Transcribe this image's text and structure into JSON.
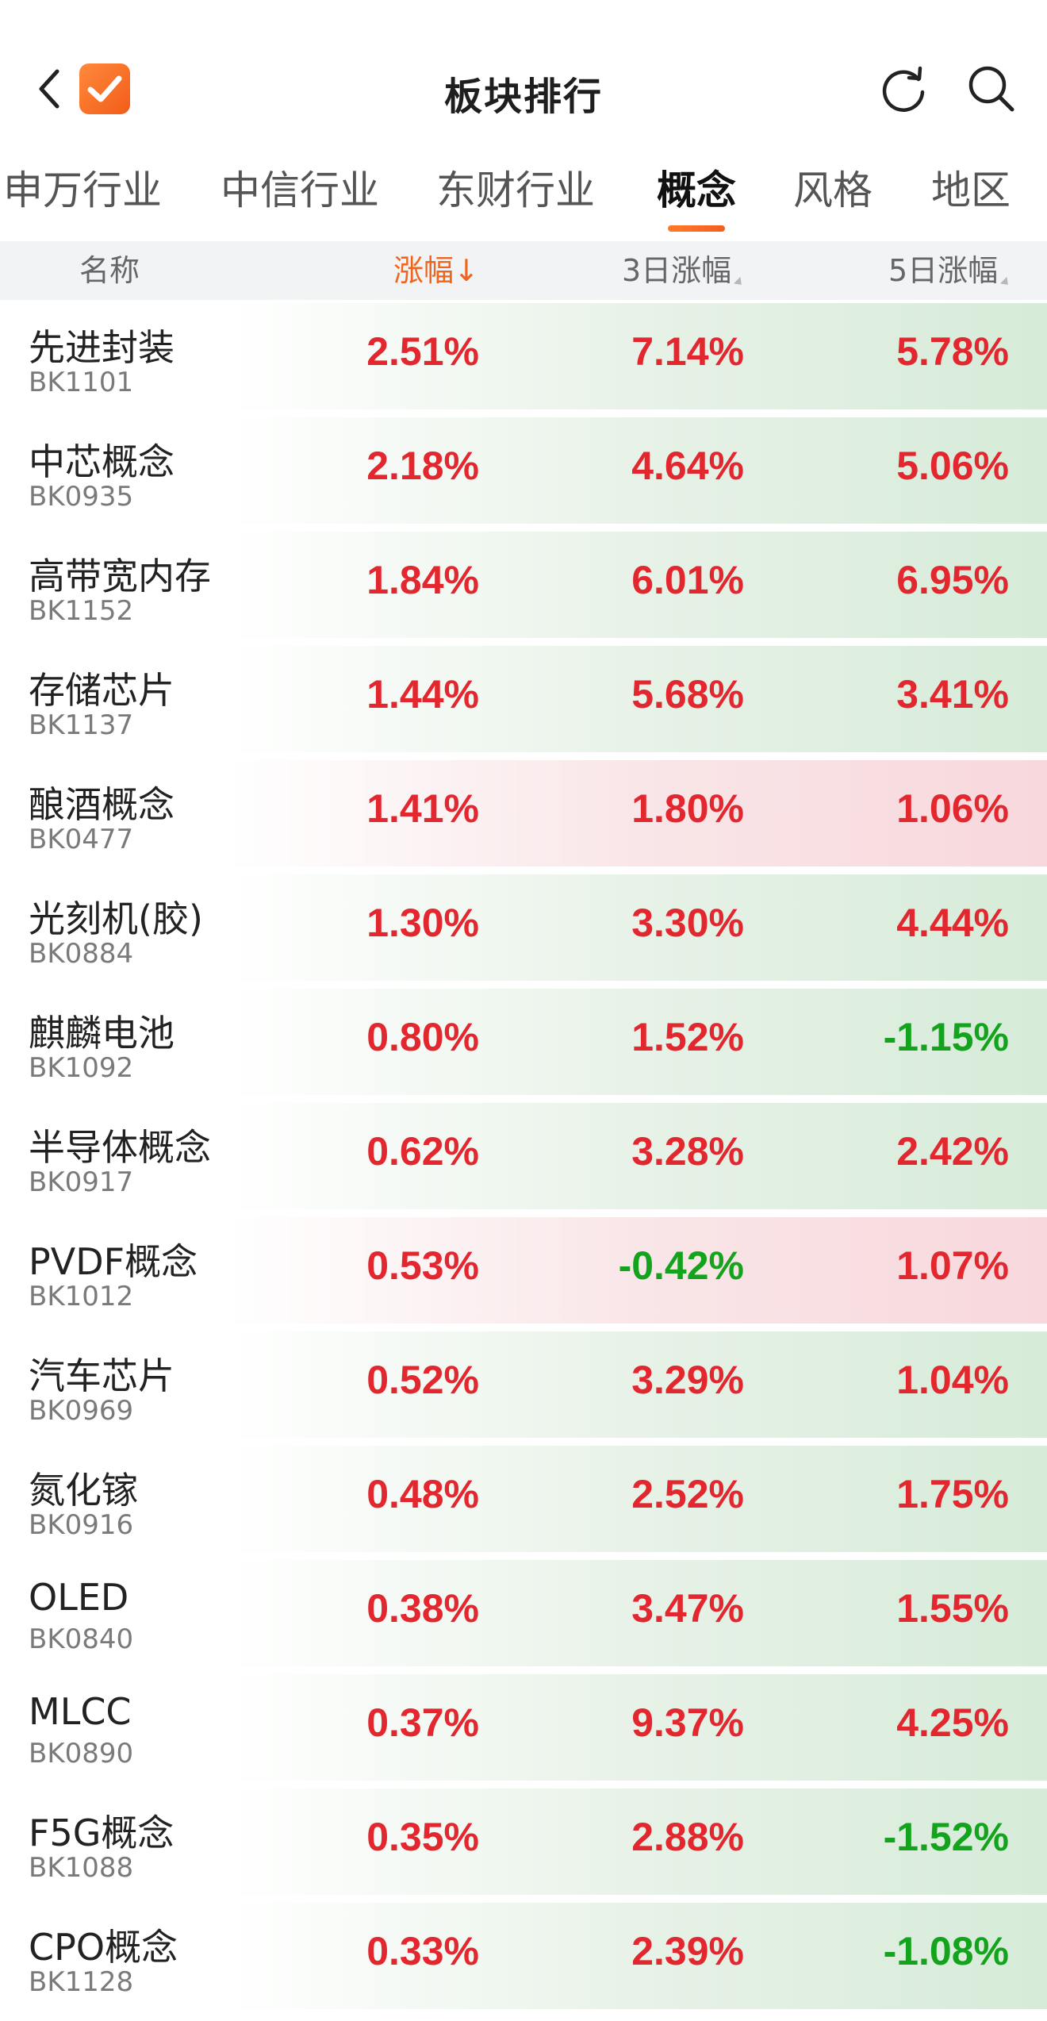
{
  "header": {
    "title": "板块排行",
    "back_icon": "chevron-left-icon",
    "logo_icon": "checkmark-logo-icon",
    "refresh_icon": "refresh-icon",
    "search_icon": "search-icon"
  },
  "tabs": [
    {
      "label": "申万行业",
      "active": false
    },
    {
      "label": "中信行业",
      "active": false
    },
    {
      "label": "东财行业",
      "active": false
    },
    {
      "label": "概念",
      "active": true
    },
    {
      "label": "风格",
      "active": false
    },
    {
      "label": "地区",
      "active": false
    }
  ],
  "columns": {
    "name": "名称",
    "change": "涨幅↓",
    "change_3d": "3日涨幅",
    "change_5d": "5日涨幅"
  },
  "colors": {
    "accent": "#f0651e",
    "up": "#e3272f",
    "down": "#14a31c"
  },
  "rows": [
    {
      "name": "先进封装",
      "code": "BK1101",
      "change": "2.51%",
      "change_3d": "7.14%",
      "change_5d": "5.78%",
      "tint": "up"
    },
    {
      "name": "中芯概念",
      "code": "BK0935",
      "change": "2.18%",
      "change_3d": "4.64%",
      "change_5d": "5.06%",
      "tint": "up"
    },
    {
      "name": "高带宽内存",
      "code": "BK1152",
      "change": "1.84%",
      "change_3d": "6.01%",
      "change_5d": "6.95%",
      "tint": "up"
    },
    {
      "name": "存储芯片",
      "code": "BK1137",
      "change": "1.44%",
      "change_3d": "5.68%",
      "change_5d": "3.41%",
      "tint": "up"
    },
    {
      "name": "酿酒概念",
      "code": "BK0477",
      "change": "1.41%",
      "change_3d": "1.80%",
      "change_5d": "1.06%",
      "tint": "down"
    },
    {
      "name": "光刻机(胶)",
      "code": "BK0884",
      "change": "1.30%",
      "change_3d": "3.30%",
      "change_5d": "4.44%",
      "tint": "up"
    },
    {
      "name": "麒麟电池",
      "code": "BK1092",
      "change": "0.80%",
      "change_3d": "1.52%",
      "change_5d": "-1.15%",
      "tint": "up"
    },
    {
      "name": "半导体概念",
      "code": "BK0917",
      "change": "0.62%",
      "change_3d": "3.28%",
      "change_5d": "2.42%",
      "tint": "up"
    },
    {
      "name": "PVDF概念",
      "code": "BK1012",
      "change": "0.53%",
      "change_3d": "-0.42%",
      "change_5d": "1.07%",
      "tint": "down"
    },
    {
      "name": "汽车芯片",
      "code": "BK0969",
      "change": "0.52%",
      "change_3d": "3.29%",
      "change_5d": "1.04%",
      "tint": "up"
    },
    {
      "name": "氮化镓",
      "code": "BK0916",
      "change": "0.48%",
      "change_3d": "2.52%",
      "change_5d": "1.75%",
      "tint": "up"
    },
    {
      "name": "OLED",
      "code": "BK0840",
      "change": "0.38%",
      "change_3d": "3.47%",
      "change_5d": "1.55%",
      "tint": "up"
    },
    {
      "name": "MLCC",
      "code": "BK0890",
      "change": "0.37%",
      "change_3d": "9.37%",
      "change_5d": "4.25%",
      "tint": "up"
    },
    {
      "name": "F5G概念",
      "code": "BK1088",
      "change": "0.35%",
      "change_3d": "2.88%",
      "change_5d": "-1.52%",
      "tint": "up"
    },
    {
      "name": "CPO概念",
      "code": "BK1128",
      "change": "0.33%",
      "change_3d": "2.39%",
      "change_5d": "-1.08%",
      "tint": "up"
    }
  ]
}
